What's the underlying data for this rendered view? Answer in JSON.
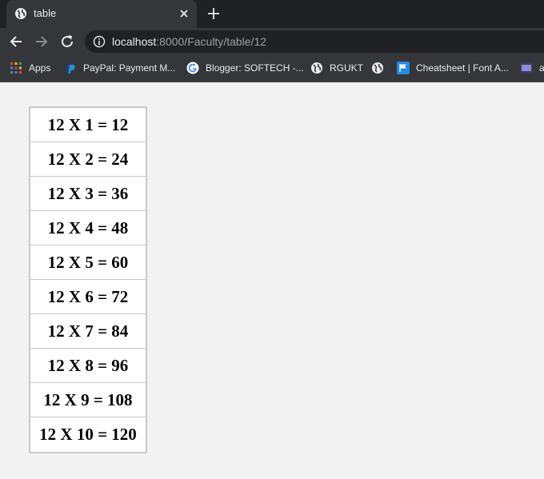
{
  "browser": {
    "tab_title": "table",
    "url_host": "localhost",
    "url_rest": ":8000/Faculty/table/12"
  },
  "bookmarks": [
    {
      "label": "Apps",
      "icon": "apps-grid-icon"
    },
    {
      "label": "PayPal: Payment M...",
      "icon": "paypal-icon"
    },
    {
      "label": "Blogger: SOFTECH -...",
      "icon": "google-icon"
    },
    {
      "label": "RGUKT",
      "icon": "globe-icon"
    },
    {
      "label": "",
      "icon": "globe-icon"
    },
    {
      "label": "Cheatsheet | Font A...",
      "icon": "flag-icon"
    },
    {
      "label": "a",
      "icon": "media-icon"
    }
  ],
  "table": {
    "rows": [
      "12 X 1 = 12",
      "12 X 2 = 24",
      "12 X 3 = 36",
      "12 X 4 = 48",
      "12 X 5 = 60",
      "12 X 6 = 72",
      "12 X 7 = 84",
      "12 X 8 = 96",
      "12 X 9 = 108",
      "12 X 10 = 120"
    ]
  }
}
